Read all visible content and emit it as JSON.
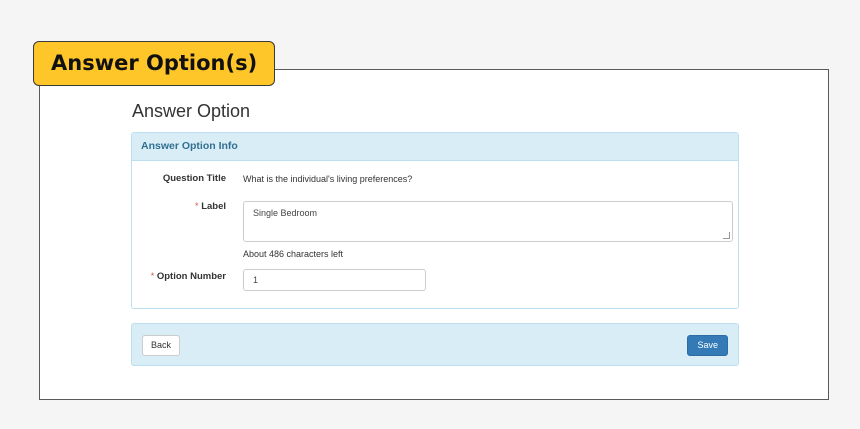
{
  "callout": {
    "title": "Answer Option(s)"
  },
  "page": {
    "title": "Answer Option"
  },
  "info_panel": {
    "heading": "Answer Option Info",
    "question_title_label": "Question Title",
    "question_title_value": "What is the individual's living preferences?",
    "label_label": "Label",
    "label_value": "Single Bedroom",
    "chars_left": "About 486 characters left",
    "option_number_label": "Option Number",
    "option_number_value": "1",
    "required_marker": "*"
  },
  "footer": {
    "back_label": "Back",
    "save_label": "Save"
  },
  "colors": {
    "callout_bg": "#ffc629",
    "panel_heading_bg": "#d9edf7",
    "panel_heading_text": "#31708f",
    "primary_button": "#337ab7",
    "required": "#d9534f"
  }
}
